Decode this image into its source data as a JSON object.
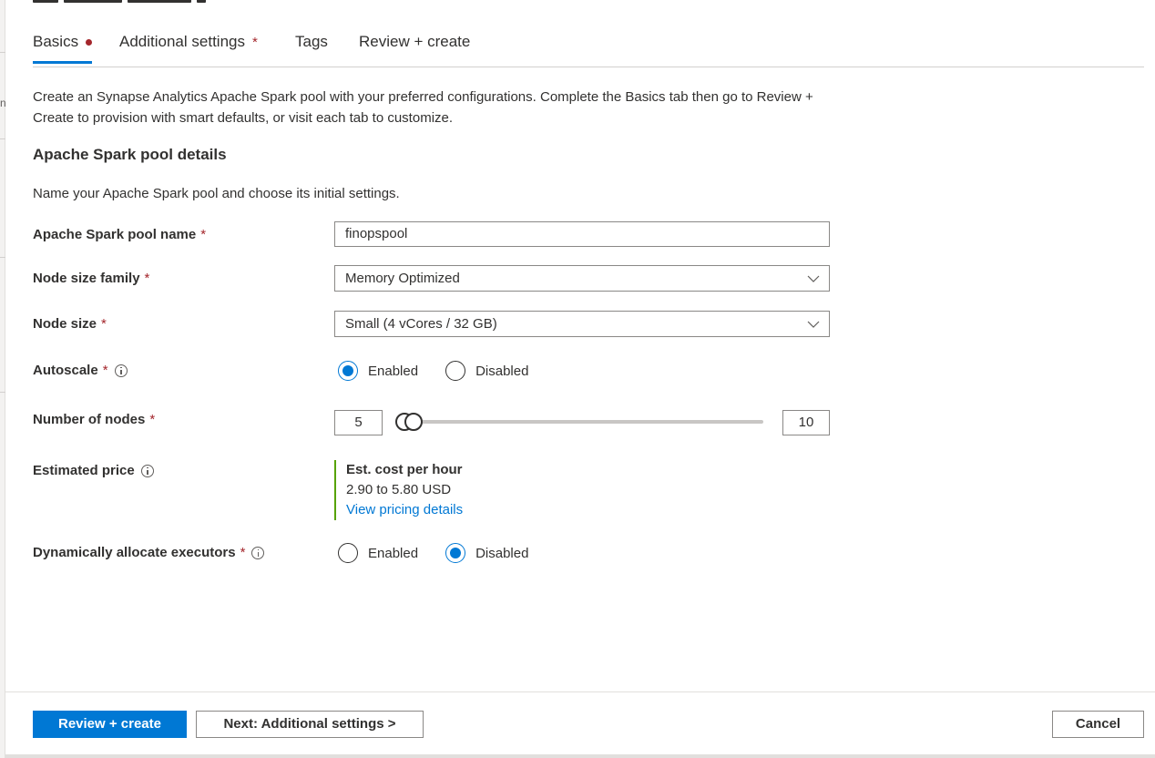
{
  "left_edge": {
    "fragment": "n"
  },
  "tabs": [
    {
      "label": "Basics",
      "marker": "dot",
      "active": true
    },
    {
      "label": "Additional settings",
      "marker": "*",
      "active": false
    },
    {
      "label": "Tags",
      "marker": "",
      "active": false
    },
    {
      "label": "Review + create",
      "marker": "",
      "active": false
    }
  ],
  "description": "Create an Synapse Analytics Apache Spark pool with your preferred configurations. Complete the Basics tab then go to Review + Create to provision with smart defaults, or visit each tab to customize.",
  "section_title": "Apache Spark pool details",
  "section_desc": "Name your Apache Spark pool and choose its initial settings.",
  "required_mark": "*",
  "fields": {
    "pool_name": {
      "label": "Apache Spark pool name",
      "value": "finopspool"
    },
    "node_family": {
      "label": "Node size family",
      "value": "Memory Optimized"
    },
    "node_size": {
      "label": "Node size",
      "value": "Small (4 vCores / 32 GB)"
    },
    "autoscale": {
      "label": "Autoscale",
      "options": [
        "Enabled",
        "Disabled"
      ],
      "selected": "Enabled"
    },
    "nodes": {
      "label": "Number of nodes",
      "min": "5",
      "max": "10"
    },
    "price": {
      "label": "Estimated price",
      "title": "Est. cost per hour",
      "value": "2.90 to 5.80 USD",
      "link": "View pricing details"
    },
    "executors": {
      "label": "Dynamically allocate executors",
      "options": [
        "Enabled",
        "Disabled"
      ],
      "selected": "Disabled"
    }
  },
  "footer": {
    "review_create": "Review + create",
    "next": "Next: Additional settings >",
    "cancel": "Cancel"
  },
  "colors": {
    "accent": "#0078d4",
    "required": "#a4262c",
    "price_bar": "#57a300"
  },
  "icons": [
    "info-icon",
    "chevron-down-icon"
  ]
}
